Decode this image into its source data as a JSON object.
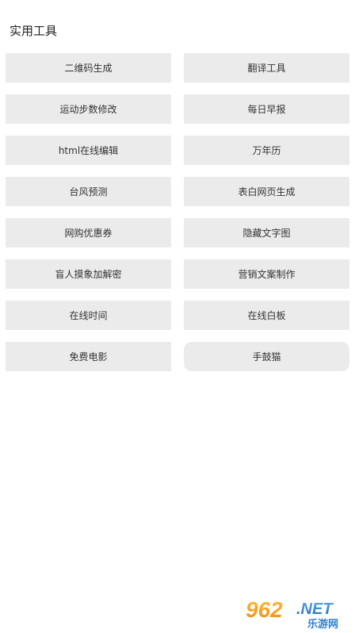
{
  "page": {
    "title": "实用工具"
  },
  "tools": [
    {
      "label": "二维码生成",
      "rounded": false
    },
    {
      "label": "翻译工具",
      "rounded": false
    },
    {
      "label": "运动步数修改",
      "rounded": false
    },
    {
      "label": "每日早报",
      "rounded": false
    },
    {
      "label": "html在线编辑",
      "rounded": false
    },
    {
      "label": "万年历",
      "rounded": false
    },
    {
      "label": "台风预测",
      "rounded": false
    },
    {
      "label": "表白网页生成",
      "rounded": false
    },
    {
      "label": "网购优惠券",
      "rounded": false
    },
    {
      "label": "隐藏文字图",
      "rounded": false
    },
    {
      "label": "盲人摸象加解密",
      "rounded": false
    },
    {
      "label": "营销文案制作",
      "rounded": false
    },
    {
      "label": "在线时间",
      "rounded": false
    },
    {
      "label": "在线白板",
      "rounded": false
    },
    {
      "label": "免费电影",
      "rounded": false
    },
    {
      "label": "手鼓猫",
      "rounded": true
    }
  ],
  "watermark": {
    "brand": "962.NET",
    "subtitle": "乐游网",
    "colors": {
      "orange": "#f39c12",
      "blue": "#2e7fd1"
    }
  },
  "colors": {
    "button_bg": "#ebebeb",
    "text": "#333333",
    "background": "#ffffff"
  }
}
